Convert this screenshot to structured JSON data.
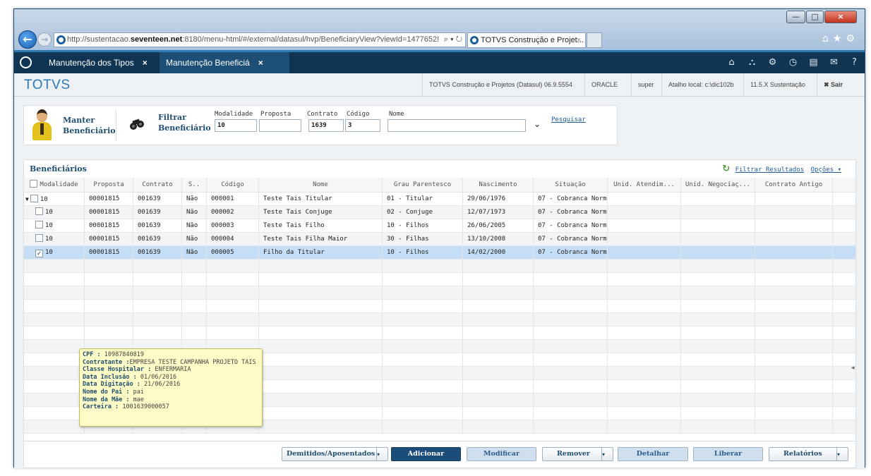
{
  "browser": {
    "url_prefix": "http://sustentacao.",
    "url_host": "seventeen.net",
    "url_rest": ":8180/menu-html/#/external/datasul/hvp/BeneficiaryView?viewId=1477652!",
    "url_controls": "⌕ ▾ ↻",
    "tab_title": "TOTVS Construção e Projet...",
    "tab_close": "×",
    "icons": "⌂★⚙"
  },
  "window_controls": {
    "minimize": "—",
    "maximize": "□",
    "close": "×"
  },
  "app_tabs": [
    {
      "label": "Manutenção dos Tipos",
      "close": "×"
    },
    {
      "label": "Manutenção Beneficiá",
      "close": "×"
    }
  ],
  "nav_icons": [
    "⌂",
    "⛬",
    "⚙",
    "◷",
    "▤",
    "✉",
    "?"
  ],
  "brand": {
    "name": "TOTVS",
    "company": "TOTVS Construção e Projetos (Datasul) 06.9.5554",
    "db": "ORACLE",
    "user": "super",
    "shortcut": "Atalho local: c:\\dic102b",
    "env": "11.5.X Sustentação",
    "exit": "✖ Sair"
  },
  "filter": {
    "manter_label_1": "Manter",
    "manter_label_2": "Beneficiário",
    "filtrar_label_1": "Filtrar",
    "filtrar_label_2": "Beneficiário",
    "labels": {
      "modalidade": "Modalidade",
      "proposta": "Proposta",
      "contrato": "Contrato",
      "codigo": "Código",
      "nome": "Nome"
    },
    "values": {
      "modalidade": "10",
      "proposta": "",
      "contrato": "1639",
      "codigo": "3",
      "nome": ""
    },
    "dropdown": "⌄",
    "search": "Pesquisar"
  },
  "grid": {
    "title": "Beneficiários",
    "refresh_icon": "↻",
    "filter_results": "Filtrar Resultados",
    "options": "Opções ▾",
    "columns": [
      "Modalidade",
      "Proposta",
      "Contrato",
      "S..",
      "Código",
      "Nome",
      "Grau Parentesco",
      "Nascimento",
      "Situação",
      "Unid. Atendim...",
      "Unid. Negociaç...",
      "Contrato Antigo"
    ],
    "rows": [
      {
        "mod": "10",
        "proposta": "00001815",
        "contrato": "001639",
        "s": "Não",
        "codigo": "000001",
        "nome": "Teste Tais Titular",
        "grau": "01 - Titular",
        "nasc": "29/06/1976",
        "sit": "07 - Cobranca Norm",
        "checked": ""
      },
      {
        "mod": "10",
        "proposta": "00001815",
        "contrato": "001639",
        "s": "Não",
        "codigo": "000002",
        "nome": "Teste Tais Conjuge",
        "grau": "02 - Conjuge",
        "nasc": "12/07/1973",
        "sit": "07 - Cobranca Norm",
        "checked": ""
      },
      {
        "mod": "10",
        "proposta": "00001815",
        "contrato": "001639",
        "s": "Não",
        "codigo": "000003",
        "nome": "Teste Tais Filho",
        "grau": "10 - Filhos",
        "nasc": "26/06/2005",
        "sit": "07 - Cobranca Norm",
        "checked": ""
      },
      {
        "mod": "10",
        "proposta": "00001815",
        "contrato": "001639",
        "s": "Não",
        "codigo": "000004",
        "nome": "Teste Tais Filha Maior",
        "grau": "30 - Filhas",
        "nasc": "13/10/2008",
        "sit": "07 - Cobranca Norm",
        "checked": ""
      },
      {
        "mod": "10",
        "proposta": "00001815",
        "contrato": "001639",
        "s": "Não",
        "codigo": "000005",
        "nome": "Filho da Titular",
        "grau": "10 - Filhos",
        "nasc": "14/02/2000",
        "sit": "07 - Cobranca Norm",
        "checked": "✓"
      }
    ],
    "expand_icon": "▼"
  },
  "tooltip": {
    "cpf_label": "CPF :",
    "cpf": "10987840819",
    "contratante_label": "Contratante :",
    "contratante": "EMPRESA TESTE CAMPANHA PROJETO TAIS",
    "classe_label": "Classe Hospitalar :",
    "classe": "ENFERMARIA",
    "inclusao_label": "Data Inclusão :",
    "inclusao": "01/06/2016",
    "digitacao_label": "Data Digitação :",
    "digitacao": "21/06/2016",
    "pai_label": "Nome do Pai :",
    "pai": "pai",
    "mae_label": "Nome da Mãe :",
    "mae": "mae",
    "carteira_label": "Carteira :",
    "carteira": "1001639000057"
  },
  "buttons": {
    "demitidos": "Demitidos/Aposentados",
    "adicionar": "Adicionar",
    "modificar": "Modificar",
    "remover": "Remover",
    "detalhar": "Detalhar",
    "liberar": "Liberar",
    "relatorios": "Relatórios",
    "dd": "▾"
  }
}
